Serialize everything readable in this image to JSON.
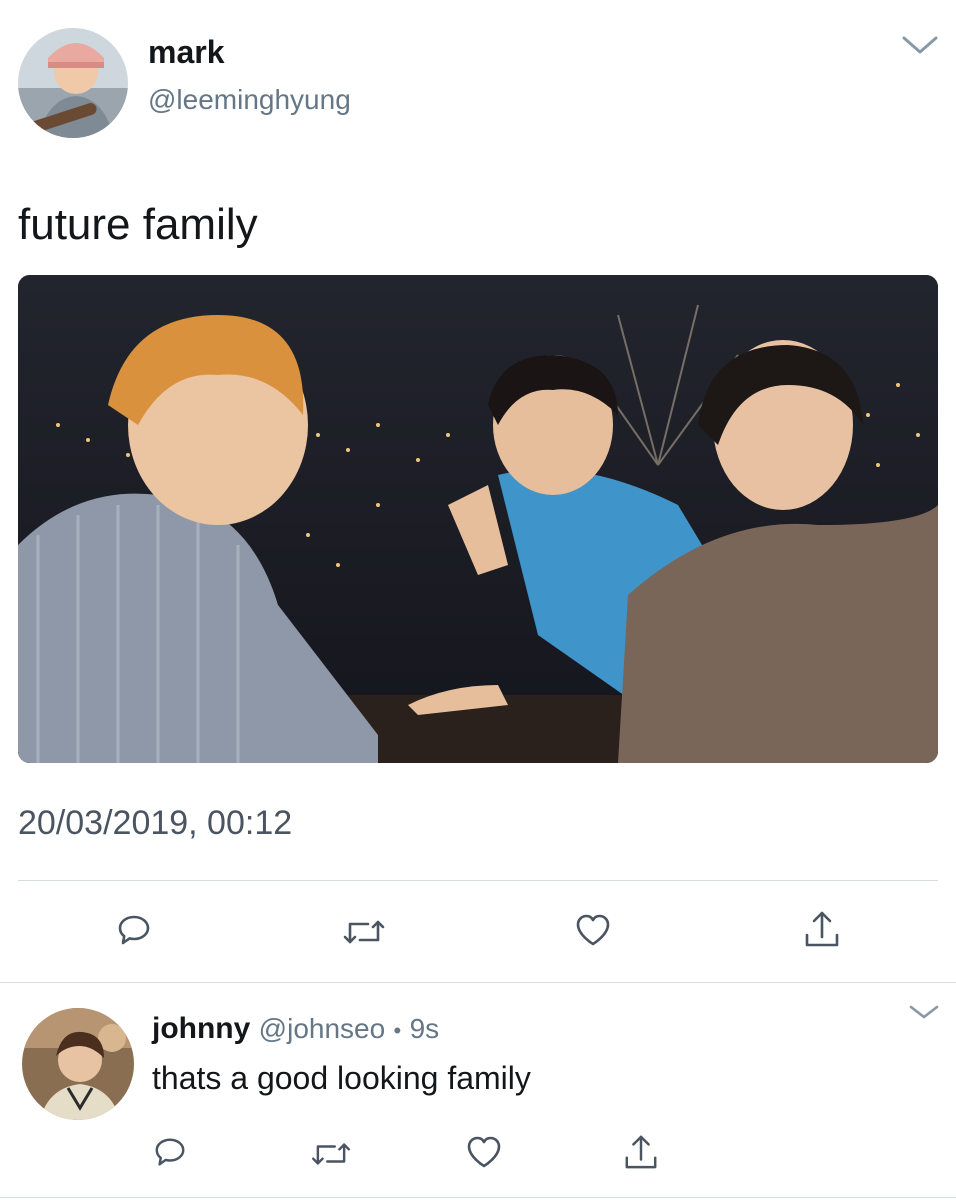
{
  "main_tweet": {
    "display_name": "mark",
    "handle": "@leeminghyung",
    "text": "future family",
    "timestamp": "20/03/2019, 00:12",
    "avatar": "avatar-photo",
    "media": "tweet-photo",
    "actions": [
      "reply-icon",
      "retweet-icon",
      "like-icon",
      "share-icon"
    ],
    "menu_icon": "chevron-down-icon"
  },
  "reply_tweet": {
    "display_name": "johnny",
    "handle": "@johnseo",
    "separator": "•",
    "time_ago": "9s",
    "text": "thats a good looking family",
    "avatar": "avatar-photo",
    "actions": [
      "reply-icon",
      "retweet-icon",
      "like-icon",
      "share-icon"
    ],
    "menu_icon": "chevron-down-icon"
  },
  "colors": {
    "text": "#14171a",
    "muted": "#657786",
    "icon": "#4a5561",
    "divider": "#d6dbdf"
  }
}
